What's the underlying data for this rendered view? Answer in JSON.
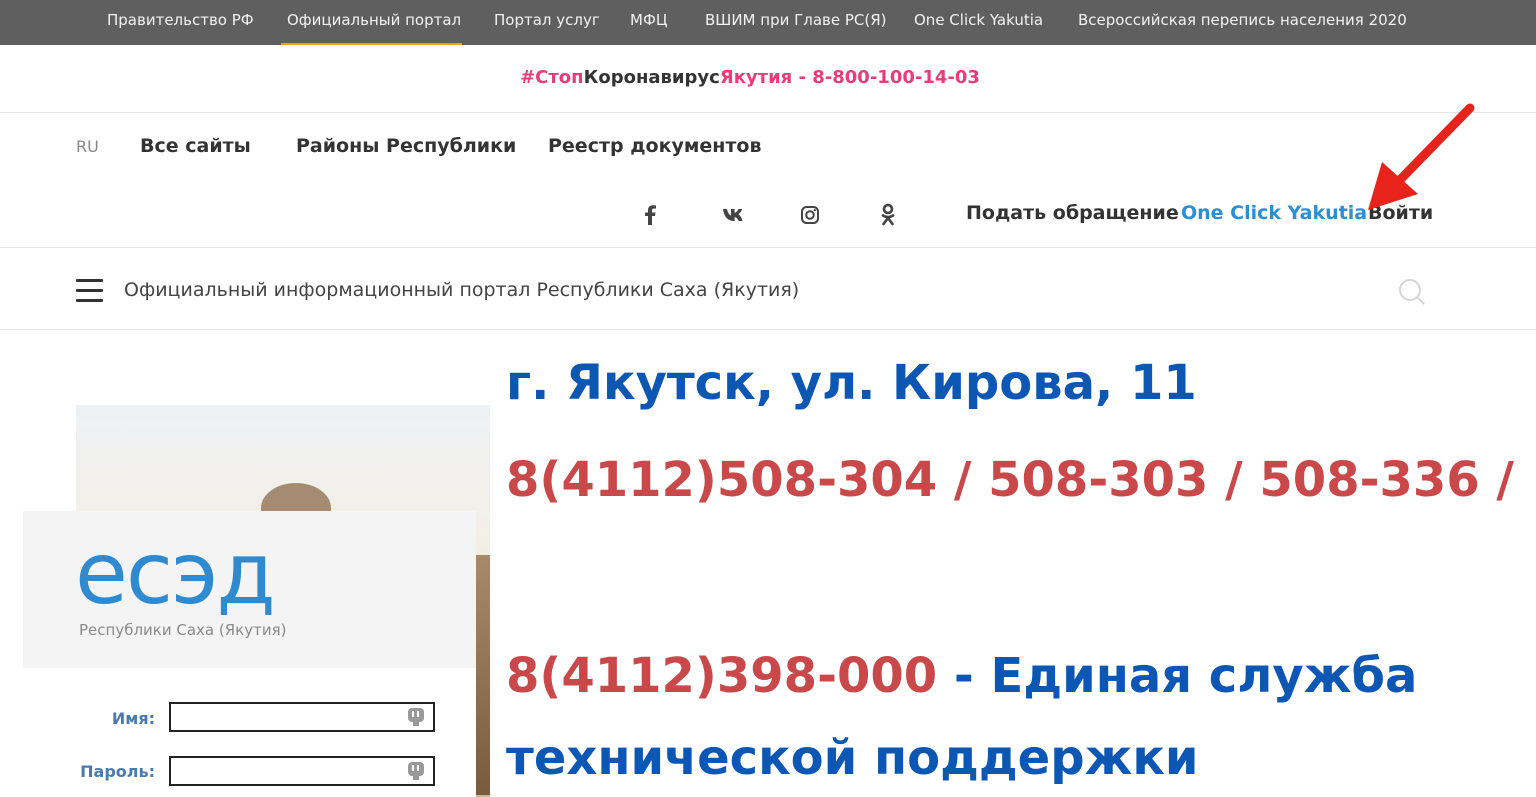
{
  "topbar": {
    "links": [
      "Правительство РФ",
      "Официальный портал",
      "Портал услуг",
      "МФЦ",
      "ВШИМ при Главе РС(Я)",
      "One Click Yakutia",
      "Всероссийская перепись населения 2020"
    ],
    "active": "Официальный портал"
  },
  "covid": {
    "hashtag_part1": "#Стоп",
    "hashtag_part2": "Коронавирус",
    "hashtag_part3": "Якутия",
    "phone": " - 8-800-100-14-03"
  },
  "nav": {
    "lang": "RU",
    "links": [
      "Все сайты",
      "Районы Республики",
      "Реестр документов"
    ],
    "social_icons": [
      "facebook-icon",
      "vk-icon",
      "instagram-icon",
      "odnoklassniki-icon"
    ],
    "appeal": "Подать обращение",
    "one_click": "One Click Yakutia",
    "login": "Войти"
  },
  "portal": {
    "title": "Официальный информационный портал Республики Саха (Якутия)"
  },
  "login_panel": {
    "logo": "есэд",
    "logo_sub": "Республики Саха (Якутия)",
    "name_label": "Имя:",
    "password_label": "Пароль:",
    "name_value": "",
    "password_value": ""
  },
  "info": {
    "address": "г. Якутск, ул. Кирова, 11",
    "phones": "8(4112)508-304 / 508-303 / 508-336 /",
    "support_phone": "8(4112)398-000",
    "support_text_1": " - Единая служба",
    "support_text_2": "технической поддержки"
  },
  "colors": {
    "topbar": "#5f5f5f",
    "accent_orange": "#f2a100",
    "pink": "#e83c7b",
    "link_blue": "#2a8fd6",
    "info_blue": "#0b57b3",
    "info_red": "#c9494a",
    "arrow_red": "#e8231c"
  }
}
